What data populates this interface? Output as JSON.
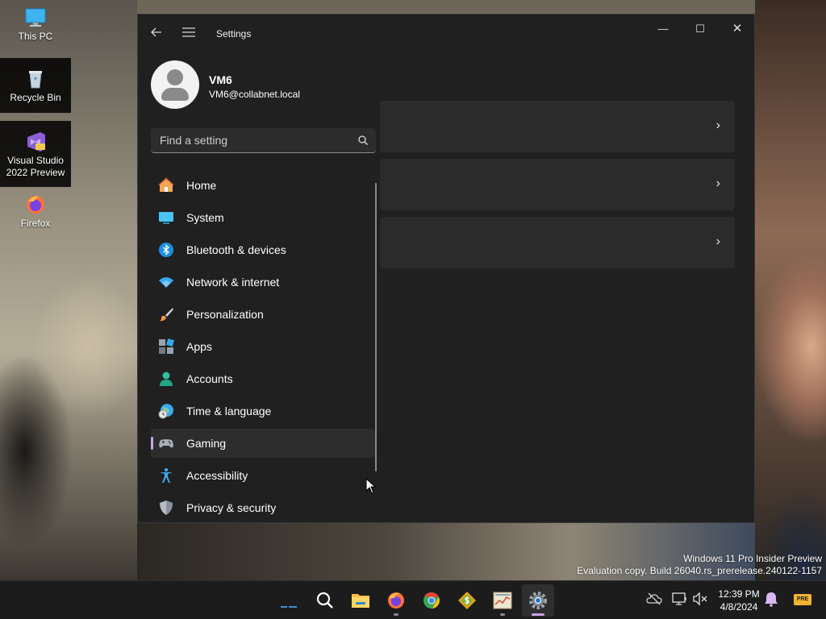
{
  "desktop": {
    "icons": [
      {
        "label": "This PC"
      },
      {
        "label": "Recycle Bin"
      },
      {
        "label": "Visual Studio 2022 Preview"
      },
      {
        "label": "Firefox"
      }
    ],
    "watermark": {
      "line1": "Windows 11 Pro Insider Preview",
      "line2": "Evaluation copy. Build 26040.rs_prerelease.240122-1157"
    }
  },
  "window": {
    "title": "Settings",
    "controls": {
      "minimize": "—",
      "maximize": "☐",
      "close": "✕"
    }
  },
  "profile": {
    "name": "VM6",
    "email": "VM6@collabnet.local"
  },
  "search": {
    "placeholder": "Find a setting"
  },
  "nav": {
    "items": [
      {
        "label": "Home",
        "icon": "home-icon"
      },
      {
        "label": "System",
        "icon": "system-icon"
      },
      {
        "label": "Bluetooth & devices",
        "icon": "bluetooth-icon"
      },
      {
        "label": "Network & internet",
        "icon": "wifi-icon"
      },
      {
        "label": "Personalization",
        "icon": "brush-icon"
      },
      {
        "label": "Apps",
        "icon": "apps-icon"
      },
      {
        "label": "Accounts",
        "icon": "account-icon"
      },
      {
        "label": "Time & language",
        "icon": "globe-clock-icon"
      },
      {
        "label": "Gaming",
        "icon": "gamepad-icon",
        "selected": true
      },
      {
        "label": "Accessibility",
        "icon": "accessibility-icon"
      },
      {
        "label": "Privacy & security",
        "icon": "shield-icon"
      }
    ]
  },
  "content": {
    "cards": [
      {
        "chevron": "›"
      },
      {
        "chevron": "›"
      },
      {
        "chevron": "›"
      }
    ]
  },
  "taskbar": {
    "apps": [
      "widgets",
      "search",
      "file-explorer",
      "firefox",
      "chrome",
      "app-dollar",
      "app-chart",
      "settings"
    ],
    "active_app": "settings",
    "clock": {
      "time": "12:39 PM",
      "date": "4/8/2024"
    },
    "tray_badge": "PRE"
  },
  "colors": {
    "window_bg": "#202020",
    "card_bg": "#2b2b2b",
    "accent": "#c9a3e6",
    "taskbar_bg": "#1c1c1c"
  }
}
